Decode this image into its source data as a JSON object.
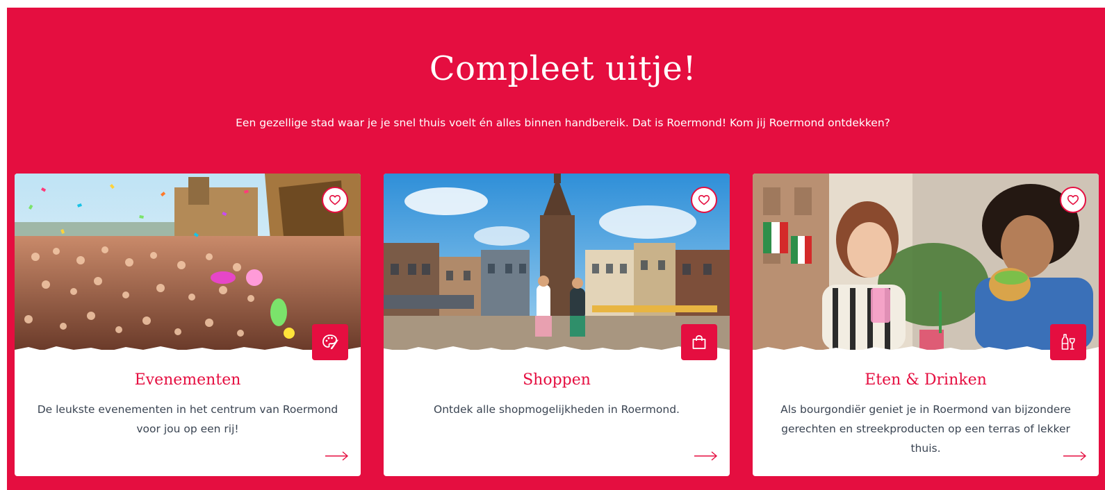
{
  "section": {
    "heading": "Compleet uitje!",
    "intro": "Een gezellige stad waar je je snel thuis voelt én alles binnen handbereik. Dat is Roermond! Kom jij Roermond ontdekken?"
  },
  "colors": {
    "accent": "#e50e40",
    "card_background": "#ffffff",
    "body_text": "#3a4452"
  },
  "cards": [
    {
      "title": "Evenementen",
      "text": "De leukste evenementen in het centrum van Roermond voor jou op een rij!",
      "category_icon": "palette-icon",
      "favorite_icon": "heart-icon",
      "link_icon": "arrow-right-icon"
    },
    {
      "title": "Shoppen",
      "text": "Ontdek alle shopmogelijkheden in Roermond.",
      "category_icon": "shopping-bag-icon",
      "favorite_icon": "heart-icon",
      "link_icon": "arrow-right-icon"
    },
    {
      "title": "Eten & Drinken",
      "text": "Als bourgondiër geniet je in Roermond van bijzondere gerechten en streekproducten op een terras of lekker thuis.",
      "category_icon": "wine-bottle-glass-icon",
      "favorite_icon": "heart-icon",
      "link_icon": "arrow-right-icon"
    }
  ]
}
